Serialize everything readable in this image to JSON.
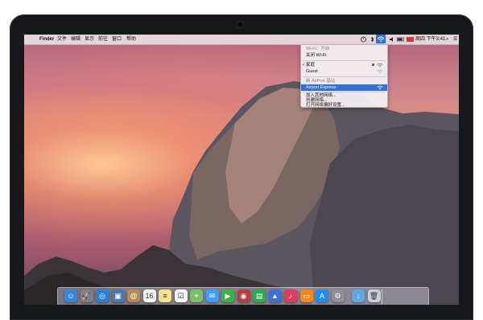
{
  "menubar": {
    "apple_glyph": "",
    "app_name": "Finder",
    "items": [
      "文件",
      "编辑",
      "显示",
      "前往",
      "窗口",
      "帮助"
    ],
    "clock": "周四 下午3:41",
    "search_glyph": "⌕",
    "user_glyph": "☰"
  },
  "wifi_menu": {
    "status": "Wi-Fi：开启",
    "turn_off": "关闭 Wi-Fi",
    "networks": [
      {
        "name": "家庭",
        "checked": true,
        "locked": true
      },
      {
        "name": "Guest",
        "checked": false,
        "locked": false
      }
    ],
    "new_airport_header": "新 AirPort 基站",
    "new_airport": "Airport Express",
    "join_other": "加入其他网络...",
    "create_network": "创建网络...",
    "open_prefs": "打开网络偏好设置..."
  },
  "dock": {
    "apps": [
      {
        "name": "finder-icon",
        "color": "#3a86d6",
        "glyph": "☺"
      },
      {
        "name": "launchpad-icon",
        "color": "#7a7f88",
        "glyph": "🚀"
      },
      {
        "name": "safari-icon",
        "color": "#2a7fe0",
        "glyph": "◎"
      },
      {
        "name": "photo-viewer-icon",
        "color": "#4e79a7",
        "glyph": "▣"
      },
      {
        "name": "contacts-icon",
        "color": "#b58a55",
        "glyph": "@"
      },
      {
        "name": "calendar-icon",
        "color": "#f3f3f3",
        "glyph": "16"
      },
      {
        "name": "notes-icon",
        "color": "#f2e28a",
        "glyph": "≡"
      },
      {
        "name": "reminders-icon",
        "color": "#f7f7f7",
        "glyph": "☑"
      },
      {
        "name": "maps-icon",
        "color": "#7bbf6a",
        "glyph": "⌖"
      },
      {
        "name": "messages-icon",
        "color": "#3aa0ff",
        "glyph": "✉"
      },
      {
        "name": "facetime-icon",
        "color": "#3bb34a",
        "glyph": "▶"
      },
      {
        "name": "photo-booth-icon",
        "color": "#b0413e",
        "glyph": "◉"
      },
      {
        "name": "numbers-icon",
        "color": "#2fa84f",
        "glyph": "▤"
      },
      {
        "name": "keynote-icon",
        "color": "#3d6fd8",
        "glyph": "▲"
      },
      {
        "name": "itunes-icon",
        "color": "#e23c5c",
        "glyph": "♪"
      },
      {
        "name": "ibooks-icon",
        "color": "#f08a1c",
        "glyph": "▭"
      },
      {
        "name": "app-store-icon",
        "color": "#1f8cf0",
        "glyph": "A"
      },
      {
        "name": "system-preferences-icon",
        "color": "#8d8f93",
        "glyph": "⚙"
      },
      {
        "name": "downloads-folder-icon",
        "color": "#5fa8e0",
        "glyph": "↓"
      },
      {
        "name": "trash-icon",
        "color": "#c8cfd6",
        "glyph": "🗑"
      }
    ]
  }
}
